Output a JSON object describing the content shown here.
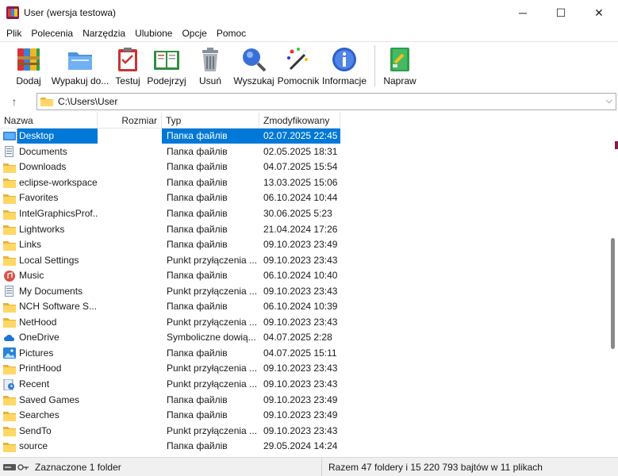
{
  "window": {
    "title": "User (wersja testowa)",
    "minimize": "─",
    "maximize": "☐",
    "close": "✕"
  },
  "menu": [
    "Plik",
    "Polecenia",
    "Narzędzia",
    "Ulubione",
    "Opcje",
    "Pomoc"
  ],
  "toolbar": {
    "add_label": "Dodaj",
    "extract_label": "Wypakuj do...",
    "test_label": "Testuj",
    "view_label": "Podejrzyj",
    "delete_label": "Usuń",
    "find_label": "Wyszukaj",
    "wizard_label": "Pomocnik",
    "info_label": "Informacje",
    "repair_label": "Napraw"
  },
  "address": {
    "path": "C:\\Users\\User",
    "up_icon": "↑",
    "dropdown_icon": "⌵"
  },
  "columns": {
    "name": "Nazwa",
    "size": "Rozmiar",
    "type": "Typ",
    "modified": "Zmodyfikowany",
    "sort_indicator": "^"
  },
  "files": [
    {
      "name": "Desktop",
      "type": "Папка файлів",
      "date": "02.07.2025 22:45",
      "icon": "desktop-icon",
      "selected": true
    },
    {
      "name": "Documents",
      "type": "Папка файлів",
      "date": "02.05.2025 18:31",
      "icon": "documents-icon"
    },
    {
      "name": "Downloads",
      "type": "Папка файлів",
      "date": "04.07.2025 15:54",
      "icon": "folder-icon"
    },
    {
      "name": "eclipse-workspace",
      "type": "Папка файлів",
      "date": "13.03.2025 15:06",
      "icon": "folder-icon"
    },
    {
      "name": "Favorites",
      "type": "Папка файлів",
      "date": "06.10.2024 10:44",
      "icon": "folder-icon"
    },
    {
      "name": "IntelGraphicsProf...",
      "type": "Папка файлів",
      "date": "30.06.2025 5:23",
      "icon": "folder-icon"
    },
    {
      "name": "Lightworks",
      "type": "Папка файлів",
      "date": "21.04.2024 17:26",
      "icon": "folder-icon"
    },
    {
      "name": "Links",
      "type": "Папка файлів",
      "date": "09.10.2023 23:49",
      "icon": "folder-icon"
    },
    {
      "name": "Local Settings",
      "type": "Punkt przyłączenia ...",
      "date": "09.10.2023 23:43",
      "icon": "folder-icon"
    },
    {
      "name": "Music",
      "type": "Папка файлів",
      "date": "06.10.2024 10:40",
      "icon": "music-icon"
    },
    {
      "name": "My Documents",
      "type": "Punkt przyłączenia ...",
      "date": "09.10.2023 23:43",
      "icon": "documents-icon"
    },
    {
      "name": "NCH Software S...",
      "type": "Папка файлів",
      "date": "06.10.2024 10:39",
      "icon": "folder-icon"
    },
    {
      "name": "NetHood",
      "type": "Punkt przyłączenia ...",
      "date": "09.10.2023 23:43",
      "icon": "folder-icon"
    },
    {
      "name": "OneDrive",
      "type": "Symboliczne dowią...",
      "date": "04.07.2025 2:28",
      "icon": "onedrive-icon"
    },
    {
      "name": "Pictures",
      "type": "Папка файлів",
      "date": "04.07.2025 15:11",
      "icon": "pictures-icon"
    },
    {
      "name": "PrintHood",
      "type": "Punkt przyłączenia ...",
      "date": "09.10.2023 23:43",
      "icon": "folder-icon"
    },
    {
      "name": "Recent",
      "type": "Punkt przyłączenia ...",
      "date": "09.10.2023 23:43",
      "icon": "recent-icon"
    },
    {
      "name": "Saved Games",
      "type": "Папка файлів",
      "date": "09.10.2023 23:49",
      "icon": "folder-icon"
    },
    {
      "name": "Searches",
      "type": "Папка файлів",
      "date": "09.10.2023 23:49",
      "icon": "folder-icon"
    },
    {
      "name": "SendTo",
      "type": "Punkt przyłączenia ...",
      "date": "09.10.2023 23:43",
      "icon": "folder-icon"
    },
    {
      "name": "source",
      "type": "Папка файлів",
      "date": "29.05.2024 14:24",
      "icon": "folder-icon"
    }
  ],
  "status": {
    "left": "Zaznaczone 1 folder",
    "right": "Razem 47 foldery i 15 220 793 bajtów w 11 plikach"
  },
  "colors": {
    "selection": "#0078d7",
    "folder": "#ffd764",
    "brand": "#8b1a4a"
  }
}
